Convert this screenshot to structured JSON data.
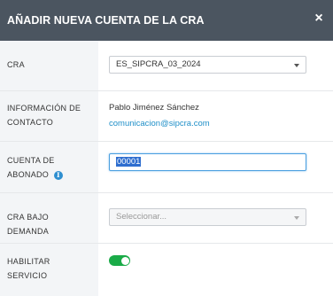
{
  "modal": {
    "title": "AÑADIR NUEVA CUENTA DE LA CRA",
    "close_icon": "×"
  },
  "fields": {
    "cra": {
      "label": "CRA",
      "value": "ES_SIPCRA_03_2024"
    },
    "contact": {
      "label_line1": "INFORMACIÓN DE",
      "label_line2": "CONTACTO",
      "name": "Pablo Jiménez Sánchez",
      "email": "comunicacion@sipcra.com"
    },
    "account": {
      "label_line1": "CUENTA DE",
      "label_line2": "ABONADO",
      "info_icon": "i",
      "value": "00001"
    },
    "on_demand": {
      "label": "CRA BAJO DEMANDA",
      "placeholder": "Seleccionar..."
    },
    "enable_service": {
      "label": "HABILITAR SERVICIO",
      "enabled": true
    }
  },
  "colors": {
    "header_bg": "#4b5560",
    "label_bg": "#f3f5f7",
    "link": "#1f8fc8",
    "toggle_on": "#1aab48",
    "focus_border": "#4a9fe0",
    "selection": "#2f6ecf"
  }
}
